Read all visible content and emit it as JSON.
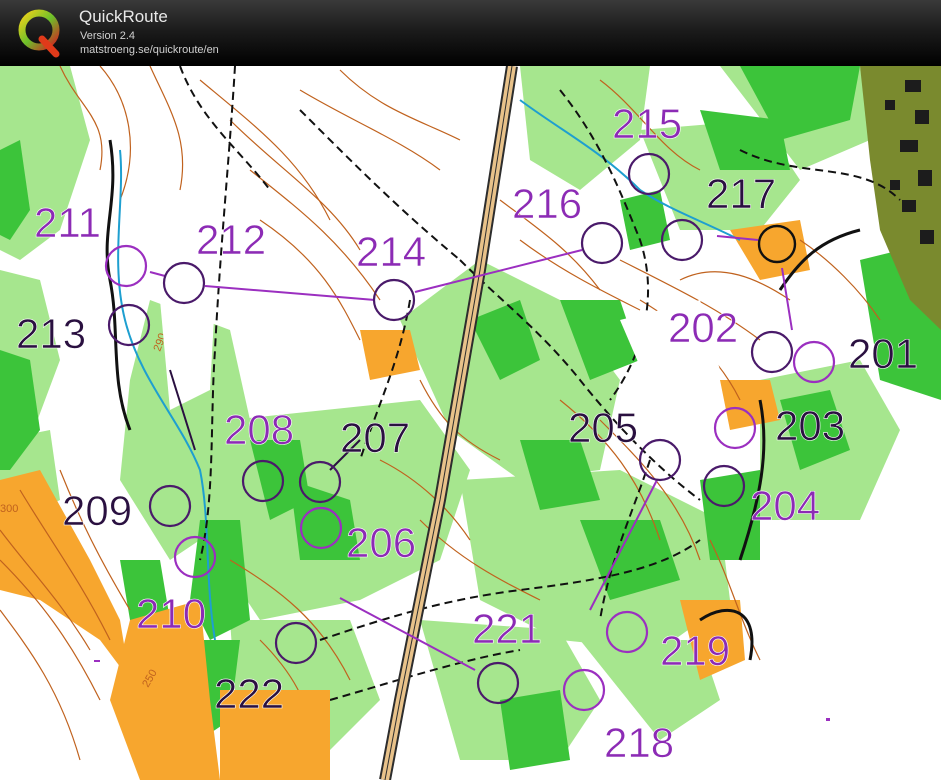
{
  "app": {
    "title": "QuickRoute",
    "version": "Version 2.4",
    "url": "matstroeng.se/quickroute/en"
  },
  "colors": {
    "course_purple": "#9b2fc0",
    "label_purple": "#8c2bb5",
    "label_dark": "#2a1040",
    "forest_green": "#3cc43a",
    "light_green": "#a6e68e",
    "open_yellow": "#f7a62e",
    "contour_brown": "#c0621e",
    "settlement_olive": "#7a8a2e"
  },
  "icons": {
    "logo": "quickroute-q-logo"
  },
  "map": {
    "contour_labels": [
      "290",
      "300",
      "250"
    ],
    "controls": [
      {
        "code": "201"
      },
      {
        "code": "202"
      },
      {
        "code": "203"
      },
      {
        "code": "204"
      },
      {
        "code": "205"
      },
      {
        "code": "206"
      },
      {
        "code": "207"
      },
      {
        "code": "208"
      },
      {
        "code": "209"
      },
      {
        "code": "210"
      },
      {
        "code": "211"
      },
      {
        "code": "212"
      },
      {
        "code": "213"
      },
      {
        "code": "214"
      },
      {
        "code": "215"
      },
      {
        "code": "216"
      },
      {
        "code": "217"
      },
      {
        "code": "218"
      },
      {
        "code": "219"
      },
      {
        "code": "221"
      },
      {
        "code": "222"
      }
    ]
  }
}
